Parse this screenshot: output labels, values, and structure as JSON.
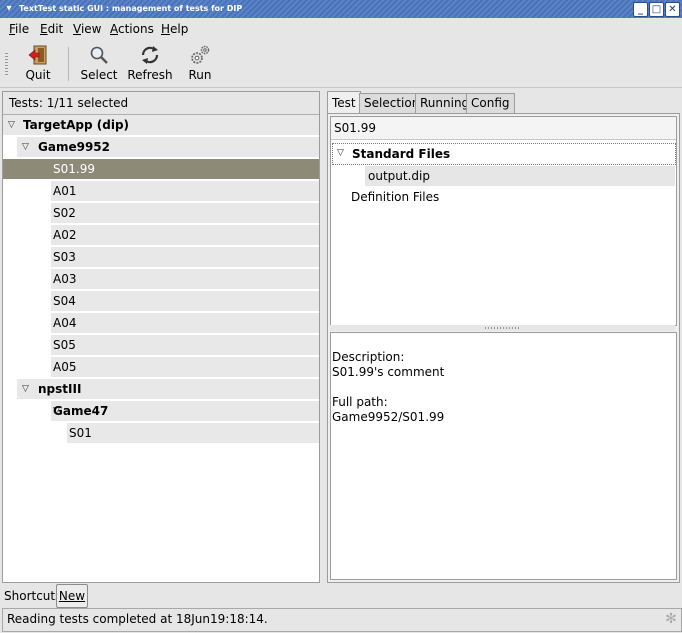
{
  "window": {
    "title": "TextTest static GUI : management of tests for DIP",
    "buttons": [
      "_",
      "□",
      "✕"
    ]
  },
  "menubar": {
    "items": [
      {
        "label": "File",
        "mnemonic": "F",
        "rest": "ile"
      },
      {
        "label": "Edit",
        "mnemonic": "E",
        "rest": "dit"
      },
      {
        "label": "View",
        "mnemonic": "V",
        "rest": "iew"
      },
      {
        "label": "Actions",
        "mnemonic": "A",
        "rest": "ctions"
      },
      {
        "label": "Help",
        "mnemonic": "H",
        "rest": "elp"
      }
    ]
  },
  "toolbar": {
    "quit_label": "Quit",
    "select_label": "Select",
    "refresh_label": "Refresh",
    "run_label": "Run"
  },
  "test_tree": {
    "header": "Tests: 1/11 selected",
    "rows": [
      {
        "label": "TargetApp (dip)",
        "level": 0,
        "expander": "▽",
        "bold": true,
        "selected": false
      },
      {
        "label": "Game9952",
        "level": 1,
        "expander": "▽",
        "bold": true,
        "selected": false
      },
      {
        "label": "S01.99",
        "level": 2,
        "expander": "",
        "bold": false,
        "selected": true
      },
      {
        "label": "A01",
        "level": 2,
        "expander": "",
        "bold": false,
        "selected": false
      },
      {
        "label": "S02",
        "level": 2,
        "expander": "",
        "bold": false,
        "selected": false
      },
      {
        "label": "A02",
        "level": 2,
        "expander": "",
        "bold": false,
        "selected": false
      },
      {
        "label": "S03",
        "level": 2,
        "expander": "",
        "bold": false,
        "selected": false
      },
      {
        "label": "A03",
        "level": 2,
        "expander": "",
        "bold": false,
        "selected": false
      },
      {
        "label": "S04",
        "level": 2,
        "expander": "",
        "bold": false,
        "selected": false
      },
      {
        "label": "A04",
        "level": 2,
        "expander": "",
        "bold": false,
        "selected": false
      },
      {
        "label": "S05",
        "level": 2,
        "expander": "",
        "bold": false,
        "selected": false
      },
      {
        "label": "A05",
        "level": 2,
        "expander": "",
        "bold": false,
        "selected": false
      },
      {
        "label": "npstIII",
        "level": 1,
        "expander": "▽",
        "bold": true,
        "selected": false
      },
      {
        "label": "Game47",
        "level": 2,
        "expander": "▽",
        "bold": true,
        "selected": false
      },
      {
        "label": "S01",
        "level": 3,
        "expander": "",
        "bold": false,
        "selected": false
      }
    ]
  },
  "tabs": [
    "Test",
    "Selection",
    "Running",
    "Config"
  ],
  "file_view": {
    "path": "S01.99",
    "standard_files_label": "Standard Files",
    "standard_files_expander": "▽",
    "output_file": "output.dip",
    "definition_files_label": "Definition Files"
  },
  "info": {
    "description_label": "Description:",
    "description": "S01.99's comment",
    "full_path_label": "Full path:",
    "full_path": "Game9952/S01.99"
  },
  "shortcuts": {
    "label": "Shortcuts:",
    "new_label": "New"
  },
  "status": {
    "text": "Reading tests completed at 18Jun19:18:14."
  }
}
